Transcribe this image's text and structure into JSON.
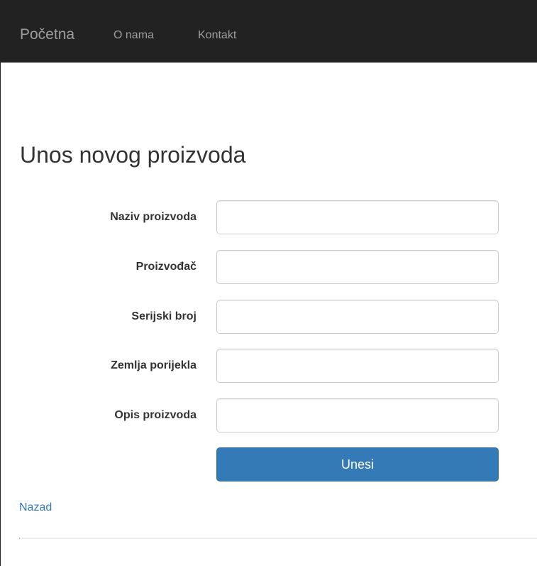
{
  "navbar": {
    "brand": "Početna",
    "links": [
      {
        "label": "O nama"
      },
      {
        "label": "Kontakt"
      }
    ]
  },
  "page": {
    "title": "Unos novog proizvoda"
  },
  "form": {
    "fields": [
      {
        "label": "Naziv proizvoda",
        "value": ""
      },
      {
        "label": "Proizvođač",
        "value": ""
      },
      {
        "label": "Serijski broj",
        "value": ""
      },
      {
        "label": "Zemlja porijekla",
        "value": ""
      },
      {
        "label": "Opis proizvoda",
        "value": ""
      }
    ],
    "submit_label": "Unesi"
  },
  "footer": {
    "back_link": "Nazad"
  },
  "colors": {
    "navbar_bg": "#222222",
    "nav_text": "#9d9d9d",
    "primary": "#337ab7",
    "link": "#337ab7"
  }
}
